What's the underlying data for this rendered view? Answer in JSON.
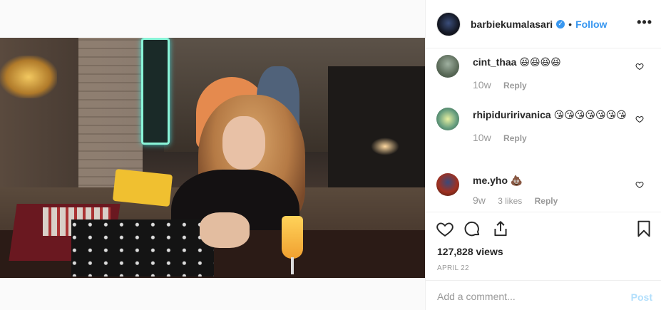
{
  "post": {
    "author": "barbiekumalasari",
    "follow_label": "Follow",
    "separator": "•",
    "more_label": "•••",
    "views": "127,828 views",
    "date": "APRIL 22"
  },
  "comments": [
    {
      "user": "cint_thaa",
      "text": "😆😆😆😆",
      "age": "10w",
      "likes": "",
      "reply_label": "Reply"
    },
    {
      "user": "rhipiduririvanica",
      "text": "😘😘😘😘😘😘😘",
      "age": "10w",
      "likes": "",
      "reply_label": "Reply"
    },
    {
      "user": "me.yho",
      "text": "💩",
      "age": "9w",
      "likes": "3 likes",
      "reply_label": "Reply"
    }
  ],
  "composer": {
    "placeholder": "Add a comment...",
    "post_label": "Post"
  },
  "icons": {
    "like": "heart-icon",
    "comment": "comment-bubble-icon",
    "share": "share-icon",
    "save": "bookmark-icon",
    "verified": "verified-badge-icon"
  },
  "colors": {
    "accent": "#3897f0",
    "post_disabled": "#b2dffc",
    "muted": "#999999"
  }
}
